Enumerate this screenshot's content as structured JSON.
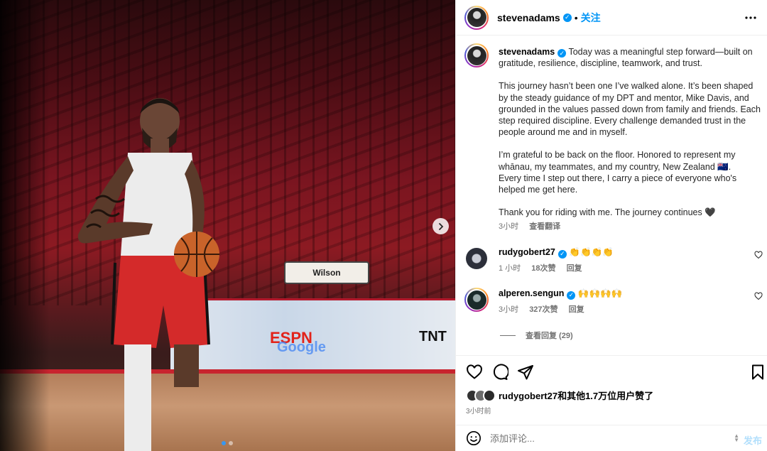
{
  "post": {
    "username": "stevenadams",
    "verified": true,
    "follow_label": "关注",
    "more_label": "more-options"
  },
  "photo": {
    "scoreboard_ads": [
      "ESPN",
      "Google",
      "TNT"
    ],
    "chair_label": "Wilson",
    "carousel": {
      "total": 2,
      "active": 1
    }
  },
  "caption": {
    "username": "stevenadams",
    "paragraphs": [
      "Today was a meaningful step forward—built on gratitude, resilience, discipline, teamwork, and trust.",
      "This journey hasn’t been one I’ve walked alone. It’s been shaped by the steady guidance of my DPT and mentor, Mike Davis, and grounded in the values passed down from family and friends. Each step required discipline. Every challenge demanded trust in the people around me and in myself.",
      "I’m grateful to be back on the floor. Honored to represent my whānau, my teammates, and my country, New Zealand 🇳🇿.\nEvery time I step out there, I carry a piece of everyone who's helped me get here.",
      "Thank you for riding with me. The journey continues 🖤"
    ],
    "time": "3小时",
    "translate": "查看翻译"
  },
  "comments": [
    {
      "username": "rudygobert27",
      "text": "👏👏👏👏",
      "time": "1 小时",
      "likes": "18次赞",
      "reply": "回复"
    },
    {
      "username": "alperen.sengun",
      "text": "🙌🙌🙌🙌",
      "time": "3小时",
      "likes": "327次赞",
      "reply": "回复"
    }
  ],
  "view_replies": "查看回复 (29)",
  "likes_text": "rudygobert27和其他1.7万位用户赞了",
  "posted_time": "3小时前",
  "composer": {
    "placeholder": "添加评论...",
    "post_label": "发布"
  },
  "colors": {
    "accent": "#0095f6",
    "muted": "#737373",
    "post_disabled": "#b2dffc"
  }
}
